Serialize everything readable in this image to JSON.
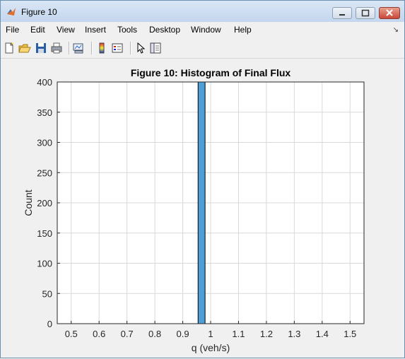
{
  "window": {
    "title": "Figure 10"
  },
  "menu": [
    "File",
    "Edit",
    "View",
    "Insert",
    "Tools",
    "Desktop",
    "Window",
    "Help"
  ],
  "toolbar": [
    "new-figure-icon",
    "open-file-icon",
    "save-icon",
    "print-icon",
    "link-plot-icon",
    "colorbar-icon",
    "legend-icon",
    "pointer-icon",
    "property-editor-icon"
  ],
  "colors": {
    "bar_fill": "#4d9fd6",
    "bar_edge": "#000000",
    "grid": "#d9d9d9"
  },
  "chart_data": {
    "type": "bar",
    "title": "Figure 10: Histogram of Final Flux",
    "xlabel": "q (veh/s)",
    "ylabel": "Count",
    "xlim": [
      0.45,
      1.55
    ],
    "ylim": [
      0,
      400
    ],
    "x_ticks": [
      "0.5",
      "0.6",
      "0.7",
      "0.8",
      "0.9",
      "1",
      "1.1",
      "1.2",
      "1.3",
      "1.4",
      "1.5"
    ],
    "y_ticks": [
      "0",
      "50",
      "100",
      "150",
      "200",
      "250",
      "300",
      "350",
      "400"
    ],
    "grid": true,
    "bins": [
      {
        "x_start": 0.955,
        "x_end": 0.98,
        "count": 400
      }
    ]
  }
}
